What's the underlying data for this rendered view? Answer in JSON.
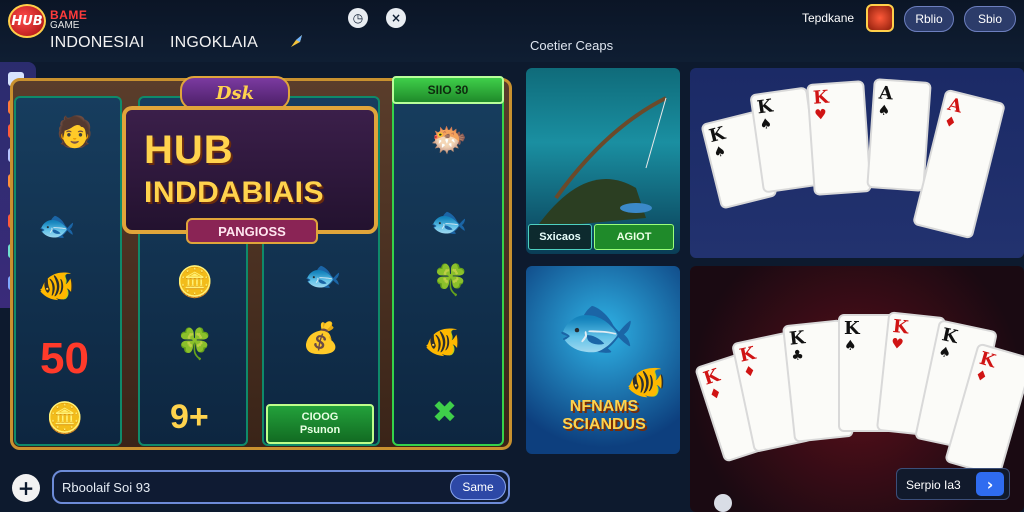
{
  "header": {
    "logo_text": "HUB",
    "brand_top": "BAME",
    "brand_sub": "GAME",
    "nav": [
      "INDONESIAI",
      "INGOKLAIA"
    ],
    "user_label": "Tepdkane",
    "login_button": "Rblio",
    "signup_button": "Sbio",
    "section_title": "Coetier Ceaps"
  },
  "icons": {
    "flag": "rocket-icon",
    "header_icon_1": "clock-icon",
    "header_icon_2": "close-icon"
  },
  "slot": {
    "crest": "Dsk",
    "top_button": "SIIO 30",
    "title_line1": "HUB",
    "title_line2": "INDDABIAIS",
    "banner": "PANGIOSS",
    "bottom_button_line1": "CIOOG",
    "bottom_button_line2": "Psunon",
    "number_symbol": "50",
    "bonus_symbol": "9+"
  },
  "cards": {
    "fishing_label_left": "Sxicaos",
    "fishing_label_right": "AGIOT",
    "fish_title": "NFNAMS SCIANDUS",
    "promo_label": "Serpio Ia3"
  },
  "search": {
    "value": "Rboolaif Soi 93",
    "button": "Same"
  },
  "colors": {
    "accent_gold": "#e0a53a",
    "accent_green": "#35d24a",
    "accent_blue": "#2f6cf0",
    "background": "#0d1a2e"
  }
}
